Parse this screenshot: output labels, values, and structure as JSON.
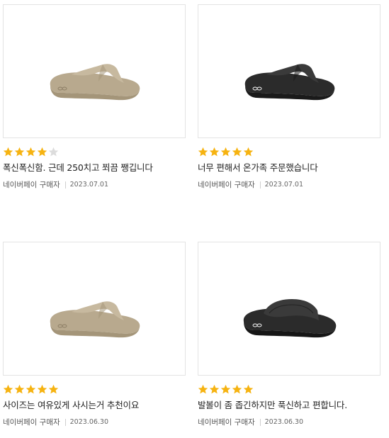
{
  "colors": {
    "star_filled": "#f6b311",
    "star_empty": "#dcdcdc",
    "sandal_beige": "#b8a98e",
    "sandal_black": "#2b2b2b"
  },
  "reviews": [
    {
      "product_image": "beige-flip-flop-sandal",
      "rating": 4,
      "text": "폭신폭신함. 근데 250치고 쬐끔 쨍깁니다",
      "author": "네이버페이 구매자",
      "date": "2023.07.01"
    },
    {
      "product_image": "black-flip-flop-sandal",
      "rating": 5,
      "text": "너무 편해서 온가족 주문했습니다",
      "author": "네이버페이 구매자",
      "date": "2023.07.01"
    },
    {
      "product_image": "beige-flip-flop-sandal",
      "rating": 5,
      "text": "사이즈는 여유있게 사시는거 추천이요",
      "author": "네이버페이 구매자",
      "date": "2023.06.30"
    },
    {
      "product_image": "black-slide-sandal",
      "rating": 5,
      "text": "발볼이 좀 좁긴하지만 푹신하고 편합니다.",
      "author": "네이버페이 구매자",
      "date": "2023.06.30"
    }
  ]
}
